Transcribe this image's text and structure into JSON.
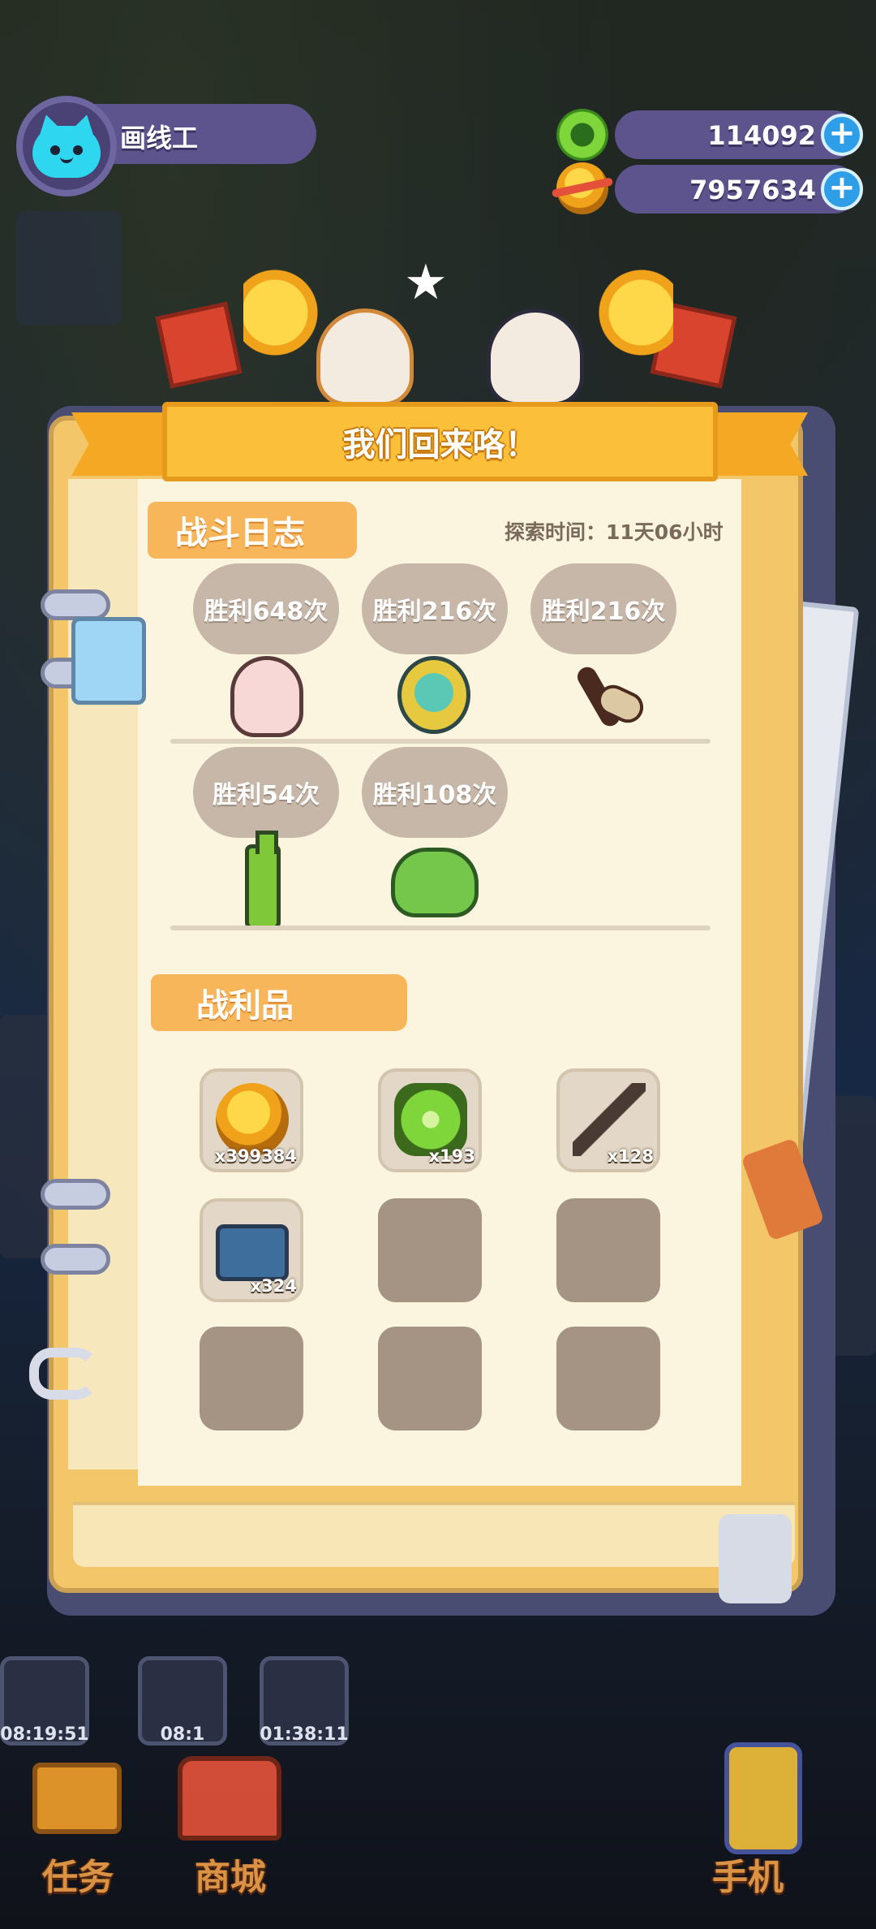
{
  "player": {
    "name": "画线工"
  },
  "currencies": [
    {
      "icon": "green-gem-icon",
      "value": "114092"
    },
    {
      "icon": "gold-coin-icon",
      "value": "7957634"
    }
  ],
  "dialog": {
    "title": "我们回来咯！",
    "battle_log": {
      "label": "战斗日志",
      "explore_time": "探索时间：11天06小时",
      "entries": [
        {
          "victory": "胜利648次",
          "enemy": "ghost-enemy-icon"
        },
        {
          "victory": "胜利216次",
          "enemy": "fan-enemy-icon"
        },
        {
          "victory": "胜利216次",
          "enemy": "moth-enemy-icon"
        },
        {
          "victory": "胜利54次",
          "enemy": "bottle-enemy-icon"
        },
        {
          "victory": "胜利108次",
          "enemy": "frog-enemy-icon"
        }
      ]
    },
    "loot": {
      "label": "战利品",
      "items": [
        {
          "icon": "gold-coin-icon",
          "count": "x399384"
        },
        {
          "icon": "clover-icon",
          "count": "x193"
        },
        {
          "icon": "bone-icon",
          "count": "x128"
        },
        {
          "icon": "machine-box-icon",
          "count": "x324"
        },
        {
          "icon": "",
          "count": ""
        },
        {
          "icon": "",
          "count": ""
        },
        {
          "icon": "",
          "count": ""
        },
        {
          "icon": "",
          "count": ""
        },
        {
          "icon": "",
          "count": ""
        }
      ]
    }
  },
  "timers": [
    "08:19:51",
    "08:1",
    "01:38:11"
  ],
  "bottom_nav": [
    {
      "label": "任务",
      "icon": "book-icon"
    },
    {
      "label": "商城",
      "icon": "shop-icon"
    },
    {
      "label": "手机",
      "icon": "phone-icon"
    }
  ],
  "colors": {
    "banner": "#fbbf3a",
    "section_tag": "#f7b65a",
    "victory_bubble": "#c6b7a9",
    "loot_slot_empty": "#a59383",
    "hud_bar": "#5d548d",
    "plus_button": "#2f9ee8"
  }
}
